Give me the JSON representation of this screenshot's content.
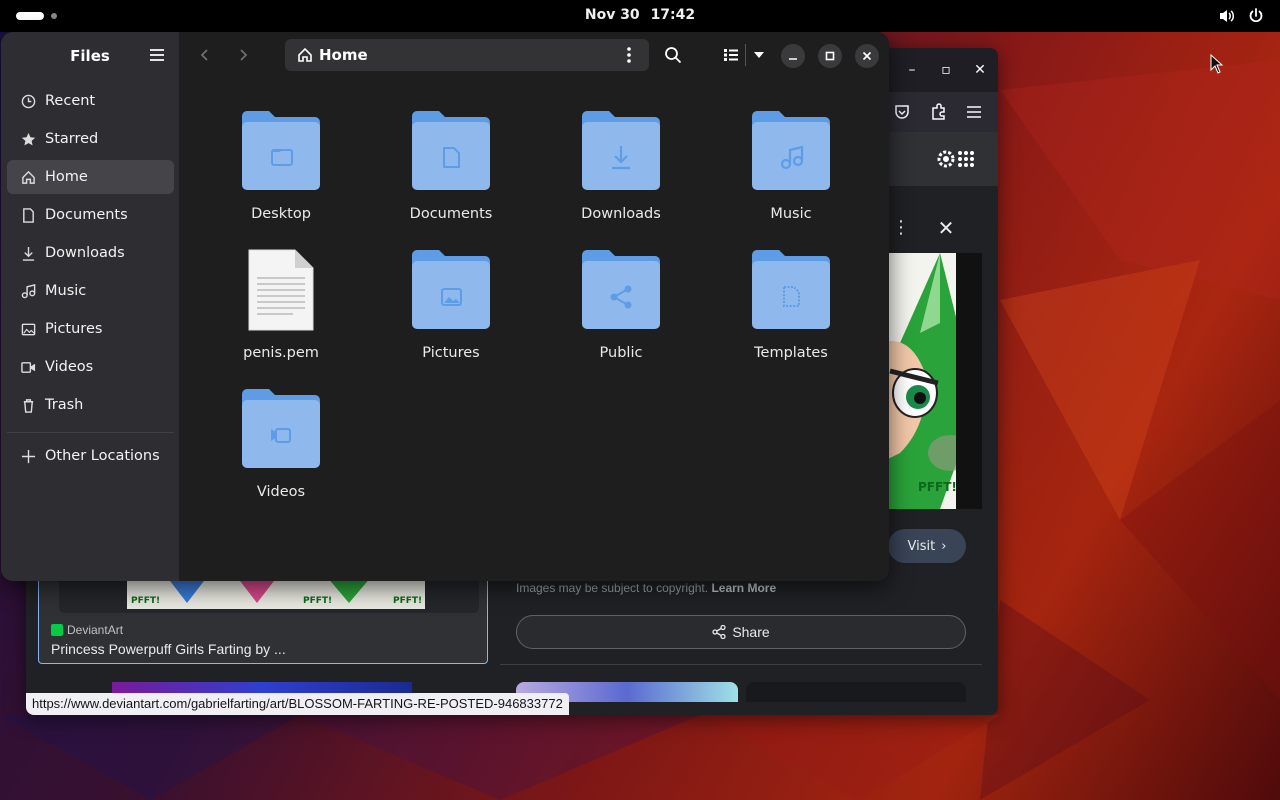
{
  "topbar": {
    "date": "Nov 30",
    "time": "17:42"
  },
  "files": {
    "app_title": "Files",
    "location": "Home",
    "sidebar": [
      {
        "label": "Recent",
        "icon": "clock-icon"
      },
      {
        "label": "Starred",
        "icon": "star-icon"
      },
      {
        "label": "Home",
        "icon": "home-icon",
        "active": true
      },
      {
        "label": "Documents",
        "icon": "document-icon"
      },
      {
        "label": "Downloads",
        "icon": "download-icon"
      },
      {
        "label": "Music",
        "icon": "music-icon"
      },
      {
        "label": "Pictures",
        "icon": "picture-icon"
      },
      {
        "label": "Videos",
        "icon": "video-icon"
      },
      {
        "label": "Trash",
        "icon": "trash-icon"
      }
    ],
    "other_locations": "Other Locations",
    "items": [
      {
        "name": "Desktop",
        "type": "folder",
        "glyph": "folder"
      },
      {
        "name": "Documents",
        "type": "folder",
        "glyph": "document"
      },
      {
        "name": "Downloads",
        "type": "folder",
        "glyph": "download"
      },
      {
        "name": "Music",
        "type": "folder",
        "glyph": "music"
      },
      {
        "name": "penis.pem",
        "type": "file",
        "glyph": "text-file"
      },
      {
        "name": "Pictures",
        "type": "folder",
        "glyph": "picture"
      },
      {
        "name": "Public",
        "type": "folder",
        "glyph": "share"
      },
      {
        "name": "Templates",
        "type": "folder",
        "glyph": "template"
      },
      {
        "name": "Videos",
        "type": "folder",
        "glyph": "video"
      }
    ]
  },
  "browser": {
    "visit_label": "Visit",
    "copyright_text": "Images may be subject to copyright.",
    "learn_more": "Learn More",
    "share_label": "Share",
    "result_source": "DeviantArt",
    "result_title": "Princess Powerpuff Girls Farting by ...",
    "status_url": "https://www.deviantart.com/gabrielfarting/art/BLOSSOM-FARTING-RE-POSTED-946833772",
    "preview_caption": "PFFT!"
  },
  "colors": {
    "folder_blue": "#8fb8ec",
    "folder_tab": "#5e9de6",
    "sidebar_bg": "#2e2e32",
    "content_bg": "#1e1e1e"
  }
}
